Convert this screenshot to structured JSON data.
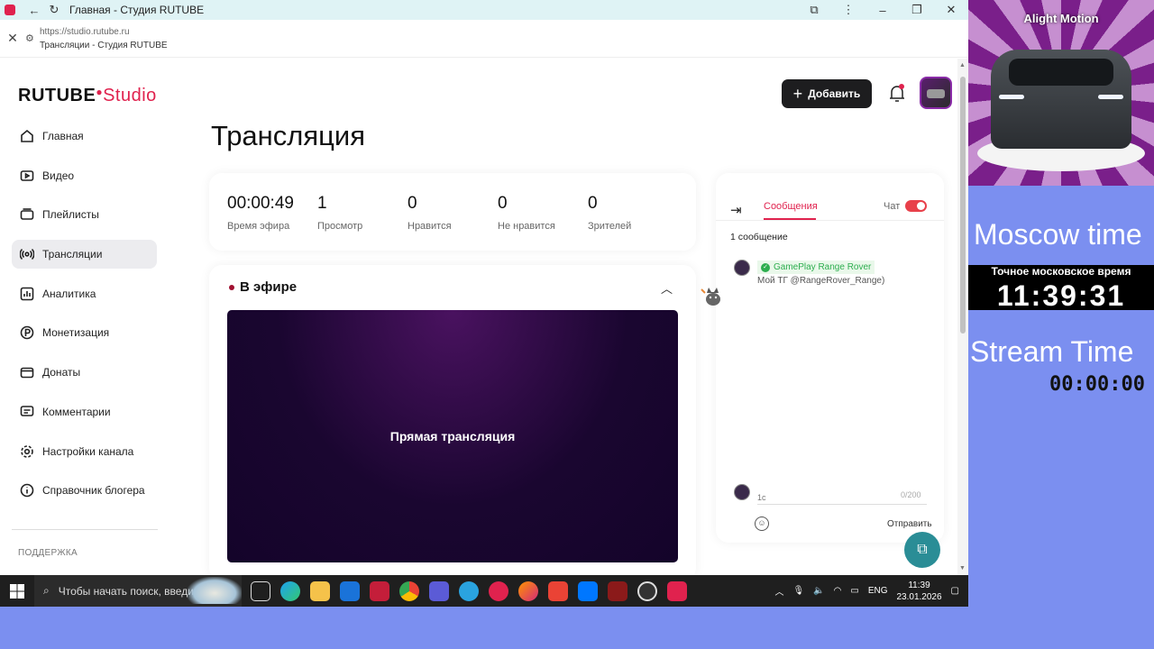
{
  "browser": {
    "tab_title": "Главная - Студия RUTUBE",
    "url": "https://studio.rutube.ru",
    "page_title": "Трансляции - Студия RUTUBE"
  },
  "header": {
    "logo_main": "RUTUBE",
    "logo_studio": "Studio",
    "add_label": "Добавить"
  },
  "sidebar": {
    "items": [
      {
        "label": "Главная",
        "icon": "home-icon"
      },
      {
        "label": "Видео",
        "icon": "video-icon"
      },
      {
        "label": "Плейлисты",
        "icon": "playlist-icon"
      },
      {
        "label": "Трансляции",
        "icon": "broadcast-icon"
      },
      {
        "label": "Аналитика",
        "icon": "analytics-icon"
      },
      {
        "label": "Монетизация",
        "icon": "monetization-icon"
      },
      {
        "label": "Донаты",
        "icon": "donate-icon"
      },
      {
        "label": "Комментарии",
        "icon": "comments-icon"
      },
      {
        "label": "Настройки канала",
        "icon": "gear-icon"
      },
      {
        "label": "Справочник блогера",
        "icon": "info-icon"
      }
    ],
    "support_label": "ПОДДЕРЖКА"
  },
  "main": {
    "title": "Трансляция",
    "stats": [
      {
        "value": "00:00:49",
        "label": "Время эфира"
      },
      {
        "value": "1",
        "label": "Просмотр"
      },
      {
        "value": "0",
        "label": "Нравится"
      },
      {
        "value": "0",
        "label": "Не нравится"
      },
      {
        "value": "0",
        "label": "Зрителей"
      }
    ],
    "live_label": "В эфире",
    "player_text": "Прямая трансляция"
  },
  "chat": {
    "tab_messages": "Сообщения",
    "chat_label": "Чат",
    "message_count": "1 сообщение",
    "messages": [
      {
        "author": "GamePlay Range Rover",
        "text": "Мой ТГ @RangeRover_Range)"
      }
    ],
    "input_placeholder": "1с",
    "char_counter": "0/200",
    "send_label": "Отправить"
  },
  "taskbar": {
    "search_placeholder": "Чтобы начать поиск, введите",
    "lang": "ENG",
    "time": "11:39",
    "date": "23.01.2026"
  },
  "overlay": {
    "app_label": "Alight Motion",
    "moscow_label": "Moscow time",
    "moscow_sub": "Точное московское время",
    "moscow_time": "11:39:31",
    "stream_label": "Stream Time",
    "stream_time": "00:00:00"
  },
  "colors": {
    "accent": "#e0224e",
    "overlay_bg": "#7b8ff0",
    "fab": "#2a8d96"
  }
}
